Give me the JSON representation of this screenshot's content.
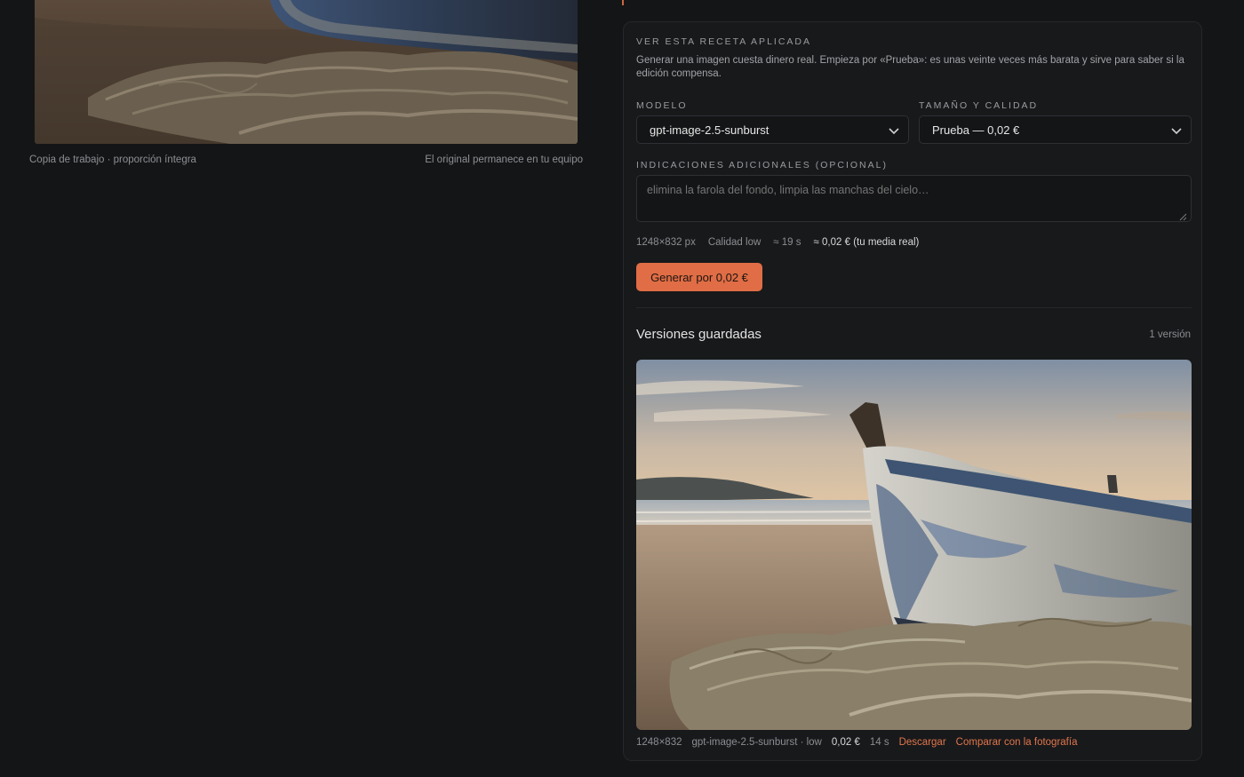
{
  "working_copy": {
    "caption_left": "Copia de trabajo · proporción íntegra",
    "caption_right": "El original permanece en tu equipo"
  },
  "apply": {
    "eyebrow": "VER ESTA RECETA APLICADA",
    "intro": "Generar una imagen cuesta dinero real. Empieza por «Prueba»: es unas veinte veces más barata y sirve para saber si la edición compensa.",
    "model_label": "MODELO",
    "model_value": "gpt-image-2.5-sunburst",
    "size_label": "TAMAÑO Y CALIDAD",
    "size_value": "Prueba — 0,02 €",
    "extra_label": "INDICACIONES ADICIONALES (OPCIONAL)",
    "extra_placeholder": "elimina la farola del fondo, limpia las manchas del cielo…",
    "meta": {
      "dims": "1248×832  px",
      "quality": "Calidad low",
      "time": "≈ 19 s",
      "cost": "≈ 0,02 € (tu media real)"
    },
    "generate_label": "Generar por 0,02 €"
  },
  "versions": {
    "title": "Versiones guardadas",
    "count": "1 versión",
    "items": [
      {
        "dims": "1248×832",
        "model": "gpt-image-2.5-sunburst · low",
        "cost": "0,02 €",
        "time": "14 s",
        "download": "Descargar",
        "compare": "Comparar con la fotografía"
      }
    ]
  },
  "colors": {
    "accent": "#e06d45",
    "background": "#141517",
    "panel": "#18191b"
  }
}
